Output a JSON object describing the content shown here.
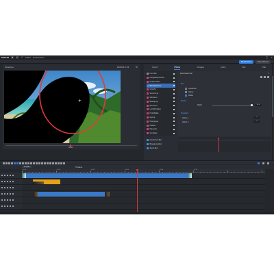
{
  "app": {
    "name": "MAGIX",
    "menu": [
      "Datei",
      "Bearbeiten"
    ]
  },
  "workspace_tabs": [
    "Bearbeiten",
    "Exportieren"
  ],
  "player": {
    "title": "Vorschau",
    "timecode": "00:00:12:14",
    "scrub_timecode": "00:12"
  },
  "effects_panel": {
    "tabs": [
      "Import",
      "Effekte",
      "Vorlagen",
      "Audio",
      "Text",
      "Titel"
    ],
    "active_tab": "Effekte",
    "list": [
      {
        "label": "Favoriten",
        "color": "#8a8f99"
      },
      {
        "label": "Helligkeit/Kontrast",
        "color": "#d0407a"
      },
      {
        "label": "Farbkorrektur",
        "color": "#d0407a"
      },
      {
        "label": "Weichzeichner",
        "color": "#3f8fe0"
      },
      {
        "label": "Schärfe",
        "color": "#d0407a"
      },
      {
        "label": "Verzerrung",
        "color": "#d0407a"
      },
      {
        "label": "Stilisieren",
        "color": "#d0407a"
      },
      {
        "label": "Bewegung",
        "color": "#d0407a"
      },
      {
        "label": "Rauschen",
        "color": "#d0407a"
      },
      {
        "label": "Licht/Schatten",
        "color": "#d0407a"
      },
      {
        "label": "Farbeffekte",
        "color": "#d0407a"
      },
      {
        "label": "Keying",
        "color": "#d0407a"
      },
      {
        "label": "Übergänge",
        "color": "#d0407a"
      },
      {
        "label": "Masken",
        "color": "#d0407a"
      },
      {
        "label": "Retusche",
        "color": "#d0407a"
      },
      {
        "label": "Sonstiges",
        "color": "#d0407a"
      }
    ],
    "selected_index": 3,
    "preview_items": [
      "Gaußscher Blur",
      "Bewegungsblur",
      "Zoom-Blur"
    ]
  },
  "properties": {
    "title": "Weichzeichner",
    "section1": "Blur",
    "rows1": [
      "Auswahlen",
      "Radius",
      "Maske"
    ],
    "check_states": [
      false,
      false,
      true
    ],
    "section2": "Stärke",
    "strength_label": "Stärke",
    "strength_value": "30.0",
    "section3": "Erweitert",
    "adv_labels": [
      "Option 1",
      "Option 2"
    ],
    "adv_values": [
      "0",
      "0"
    ]
  },
  "timeline": {
    "project_label": "Projekt",
    "title": "Timeline",
    "ruler_marks": [
      "00:00",
      "00:10",
      "00:20",
      "00:30",
      "00:40",
      "00:50"
    ]
  },
  "colors": {
    "accent": "#2f7de1",
    "playhead": "#d23b3b",
    "clip_blue": "#3c78c8",
    "clip_orange": "#e3a21a"
  }
}
